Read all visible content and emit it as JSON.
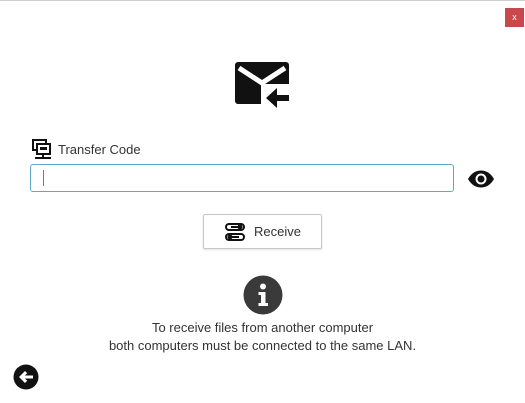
{
  "window": {
    "close_label": "x",
    "close_color": "#c9484b"
  },
  "header": {
    "icon": "mark-email-received-icon"
  },
  "code_field": {
    "label": "Transfer Code",
    "label_icon": "lan-icon",
    "value": "",
    "placeholder": "",
    "visibility_icon": "eye-icon",
    "border_color": "#5fa8c9"
  },
  "receive_button": {
    "label": "Receive",
    "icon": "route-icon"
  },
  "info": {
    "icon": "info-circle-icon",
    "line1": "To receive files from another computer",
    "line2": "both computers must be connected to the same LAN."
  },
  "navigation": {
    "back_icon": "arrow-left-circle-icon"
  }
}
